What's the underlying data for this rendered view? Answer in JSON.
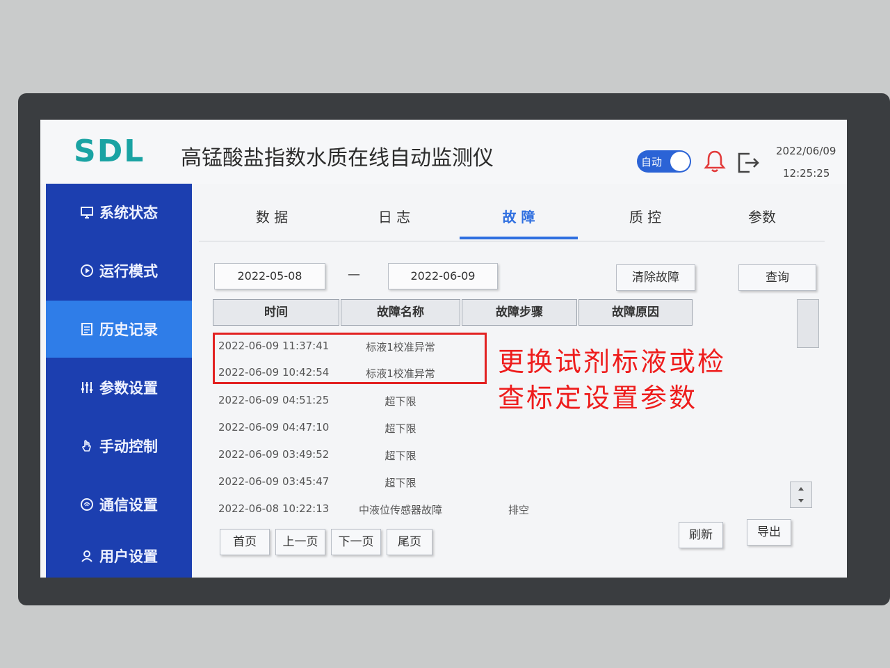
{
  "header": {
    "logo": "SDL",
    "title": "高锰酸盐指数水质在线自动监测仪",
    "mode_toggle": "自动",
    "date": "2022/06/09",
    "time": "12:25:25"
  },
  "sidebar": {
    "items": [
      {
        "label": "系统状态",
        "icon": "monitor-icon",
        "active": false
      },
      {
        "label": "运行模式",
        "icon": "play-circle-icon",
        "active": false
      },
      {
        "label": "历史记录",
        "icon": "document-icon",
        "active": true
      },
      {
        "label": "参数设置",
        "icon": "sliders-icon",
        "active": false
      },
      {
        "label": "手动控制",
        "icon": "hand-icon",
        "active": false
      },
      {
        "label": "通信设置",
        "icon": "signal-icon",
        "active": false
      },
      {
        "label": "用户设置",
        "icon": "user-icon",
        "active": false
      }
    ]
  },
  "tabs": [
    {
      "label": "数 据",
      "active": false
    },
    {
      "label": "日 志",
      "active": false
    },
    {
      "label": "故 障",
      "active": true
    },
    {
      "label": "质 控",
      "active": false
    },
    {
      "label": "参数",
      "active": false
    }
  ],
  "filter": {
    "start_date": "2022-05-08",
    "separator": "—",
    "end_date": "2022-06-09",
    "clear_button": "清除故障",
    "query_button": "查询"
  },
  "table": {
    "columns": [
      "时间",
      "故障名称",
      "故障步骤",
      "故障原因"
    ],
    "rows": [
      {
        "time": "2022-06-09 11:37:41",
        "name": "标液1校准异常",
        "step": "",
        "reason": ""
      },
      {
        "time": "2022-06-09 10:42:54",
        "name": "标液1校准异常",
        "step": "",
        "reason": ""
      },
      {
        "time": "2022-06-09 04:51:25",
        "name": "超下限",
        "step": "",
        "reason": ""
      },
      {
        "time": "2022-06-09 04:47:10",
        "name": "超下限",
        "step": "",
        "reason": ""
      },
      {
        "time": "2022-06-09 03:49:52",
        "name": "超下限",
        "step": "",
        "reason": ""
      },
      {
        "time": "2022-06-09 03:45:47",
        "name": "超下限",
        "step": "",
        "reason": ""
      },
      {
        "time": "2022-06-08 10:22:13",
        "name": "中液位传感器故障",
        "step": "排空",
        "reason": ""
      }
    ]
  },
  "pager": {
    "first": "首页",
    "prev": "上一页",
    "next": "下一页",
    "last": "尾页",
    "refresh": "刷新",
    "export": "导出"
  },
  "annotation": {
    "line1": "更换试剂标液或检",
    "line2": "查标定设置参数",
    "color": "#ee1c1c"
  },
  "colors": {
    "sidebar": "#1c3fb0",
    "sidebar_active": "#2f7de8",
    "accent": "#2f6fe0",
    "logo": "#1aa3a3"
  }
}
